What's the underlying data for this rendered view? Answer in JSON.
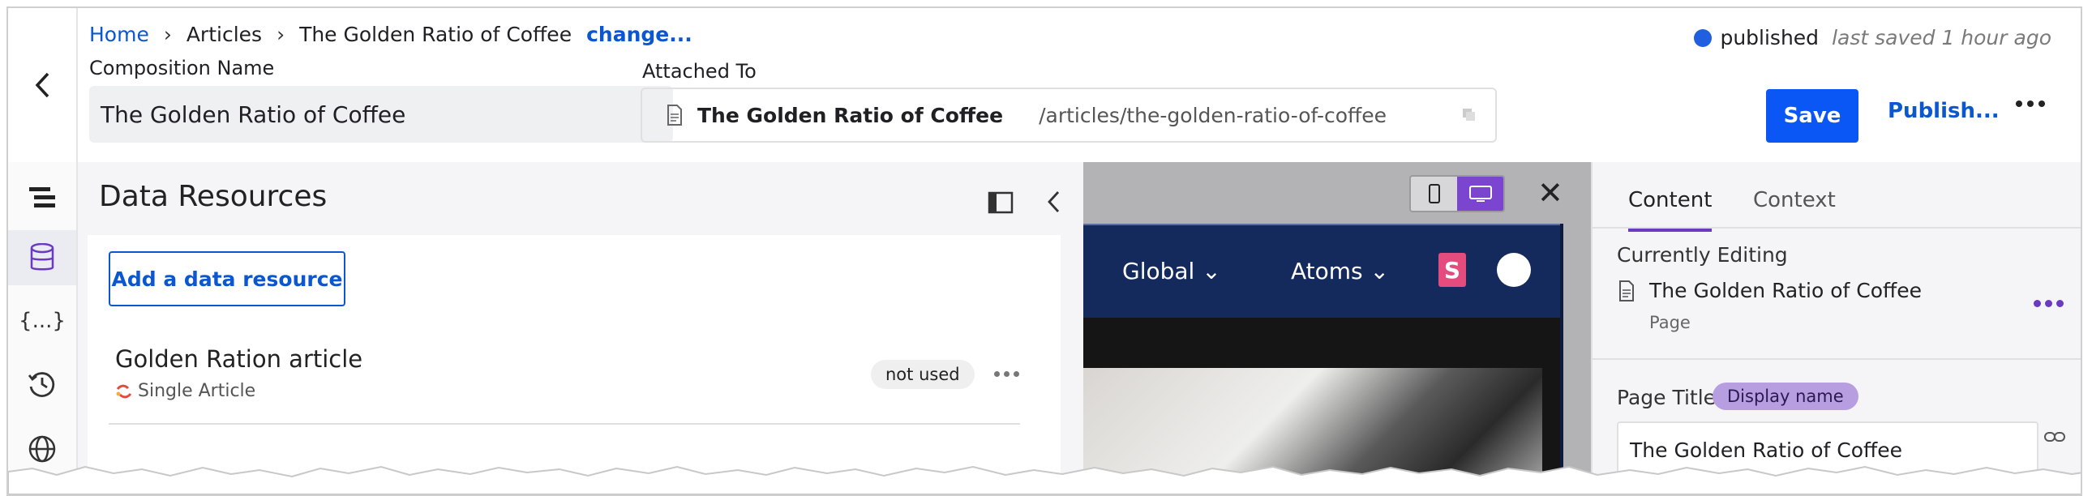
{
  "breadcrumb": {
    "home": "Home",
    "articles": "Articles",
    "current": "The Golden Ratio of Coffee",
    "change": "change..."
  },
  "status": {
    "state": "published",
    "saved": "last saved 1 hour ago",
    "dot_color": "#1f5fe0"
  },
  "composition": {
    "label": "Composition Name",
    "value": "The Golden Ratio of Coffee"
  },
  "attached": {
    "label": "Attached To",
    "title": "The Golden Ratio of Coffee",
    "path": "/articles/the-golden-ratio-of-coffee"
  },
  "actions": {
    "save": "Save",
    "publish": "Publish..."
  },
  "rail": {
    "icons": [
      "structure-icon",
      "database-icon",
      "json-icon",
      "history-icon",
      "globe-icon"
    ],
    "code_glyph": "{...}"
  },
  "panel": {
    "title": "Data Resources",
    "add_button": "Add a data resource",
    "resource": {
      "name": "Golden Ration article",
      "type": "Single Article",
      "status": "not used"
    }
  },
  "preview": {
    "nav_items": [
      "Global",
      "Atoms"
    ],
    "logo_letter": "S"
  },
  "right_panel": {
    "tabs": [
      "Content",
      "Context"
    ],
    "currently_editing_label": "Currently Editing",
    "item_title": "The Golden Ratio of Coffee",
    "item_type": "Page",
    "page_title_label": "Page Title",
    "page_title_badge": "Display name",
    "page_title_value": "The Golden Ratio of Coffee"
  },
  "colors": {
    "accent": "#0b57f5",
    "link": "#0b57d0",
    "purple": "#6a3bc0",
    "badge": "#b79ee0"
  }
}
